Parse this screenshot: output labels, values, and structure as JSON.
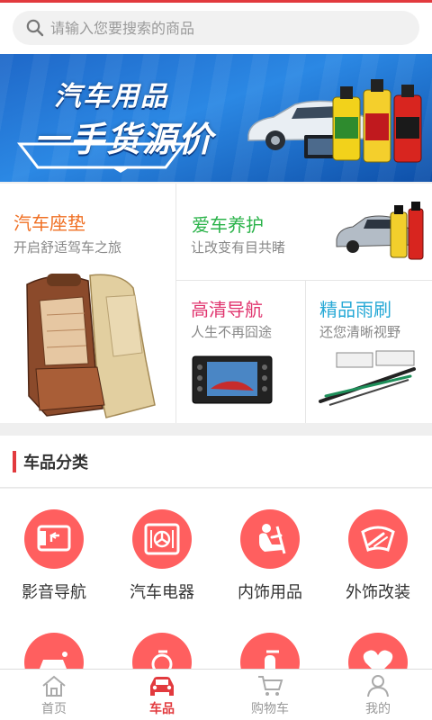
{
  "search": {
    "placeholder": "请输入您要搜索的商品"
  },
  "banner": {
    "line1": "汽车用品",
    "line2": "一手货源价"
  },
  "promos": [
    {
      "title": "汽车座垫",
      "subtitle": "开启舒适驾车之旅",
      "color": "#f07024"
    },
    {
      "title": "爱车养护",
      "subtitle": "让改变有目共睹",
      "color": "#2bb34a"
    },
    {
      "title": "高清导航",
      "subtitle": "人生不再囧途",
      "color": "#e0346e"
    },
    {
      "title": "精品雨刷",
      "subtitle": "还您清晰视野",
      "color": "#27a9d6"
    }
  ],
  "category_section": {
    "title": "车品分类"
  },
  "categories": [
    {
      "label": "影音导航",
      "icon": "monitor-icon"
    },
    {
      "label": "汽车电器",
      "icon": "fan-icon"
    },
    {
      "label": "内饰用品",
      "icon": "car-seat-icon"
    },
    {
      "label": "外饰改装",
      "icon": "windshield-icon"
    },
    {
      "label": "",
      "icon": "car-wash-icon"
    },
    {
      "label": "",
      "icon": "oil-icon"
    },
    {
      "label": "",
      "icon": "fire-extinguisher-icon"
    },
    {
      "label": "",
      "icon": "heart-icon"
    }
  ],
  "tabs": [
    {
      "label": "首页",
      "icon": "home-icon",
      "active": false
    },
    {
      "label": "车品",
      "icon": "car-icon",
      "active": true
    },
    {
      "label": "购物车",
      "icon": "cart-icon",
      "active": false
    },
    {
      "label": "我的",
      "icon": "user-icon",
      "active": false
    }
  ],
  "colors": {
    "accent": "#e23a3e",
    "category_circle": "#ff5f5f"
  }
}
